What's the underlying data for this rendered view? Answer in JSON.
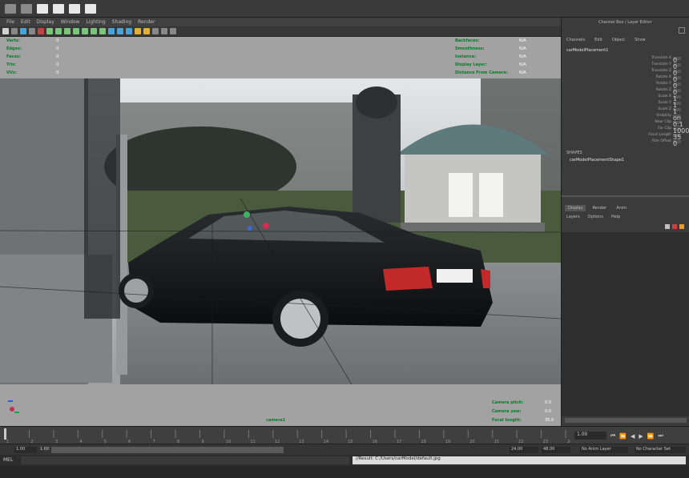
{
  "menu": {
    "items": [
      "File",
      "Edit",
      "Modify",
      "Create",
      "Display",
      "Window",
      "Lighting",
      "Shading",
      "Texturing",
      "Render",
      "Toon",
      "Help"
    ]
  },
  "attribute_editor": {
    "header": "Channel Box / Layer Editor",
    "tabs": [
      "Channels",
      "Edit",
      "Object",
      "Show"
    ],
    "node_name": "carModelPlacement1",
    "channels": [
      {
        "name": "Translate X",
        "value": "0"
      },
      {
        "name": "Translate Y",
        "value": "0"
      },
      {
        "name": "Translate Z",
        "value": "0"
      },
      {
        "name": "Rotate X",
        "value": "0"
      },
      {
        "name": "Rotate Y",
        "value": "0"
      },
      {
        "name": "Rotate Z",
        "value": "0"
      },
      {
        "name": "Scale X",
        "value": "1"
      },
      {
        "name": "Scale Y",
        "value": "1"
      },
      {
        "name": "Scale Z",
        "value": "1"
      },
      {
        "name": "Visibility",
        "value": "on"
      },
      {
        "name": "Near Clip",
        "value": "0.1"
      },
      {
        "name": "Far Clip",
        "value": "1000"
      },
      {
        "name": "Focal Length",
        "value": "35"
      },
      {
        "name": "Film Offset",
        "value": "0"
      }
    ],
    "shapes_label": "SHAPES",
    "shape_name": "carModelPlacementShape1",
    "layer_tabs": [
      "Display",
      "Render",
      "Anim"
    ],
    "layer_menu": [
      "Layers",
      "Options",
      "Help"
    ]
  },
  "hud": {
    "top_left": [
      "Verts:",
      "Edges:",
      "Faces:",
      "Tris:",
      "UVs:"
    ],
    "top_left_values": [
      "0",
      "0",
      "0",
      "0",
      "0"
    ],
    "top_right": [
      "Backfaces:",
      "Smoothness:",
      "Instance:",
      "Display Layer:",
      "Distance From Camera:"
    ],
    "top_right_values": [
      "N/A",
      "N/A",
      "N/A",
      "N/A",
      "N/A"
    ],
    "bottom_right": [
      "Camera pitch:",
      "Camera yaw:",
      "Focal length:"
    ],
    "bottom_right_values": [
      "0.0",
      "0.0",
      "35.0"
    ],
    "camera_name": "camera1"
  },
  "timeline": {
    "ticks": [
      "1",
      "2",
      "3",
      "4",
      "5",
      "6",
      "7",
      "8",
      "9",
      "10",
      "11",
      "12",
      "13",
      "14",
      "15",
      "16",
      "17",
      "18",
      "19",
      "20",
      "21",
      "22",
      "23",
      "24"
    ],
    "current_frame": "1.00"
  },
  "range": {
    "start": "1.00",
    "inner_start": "1.00",
    "end": "24.00",
    "outer_end": "48.00",
    "anim_layer": "No Anim Layer",
    "char_set": "No Character Set"
  },
  "command": {
    "mel_label": "MEL",
    "value": "//Result: C:/Users/carModel/default.jpg"
  },
  "colors": {
    "hud_green": "#0a7a2a",
    "hud_bg": "#a2a2a2",
    "panel_bg": "#3b3b3b"
  }
}
